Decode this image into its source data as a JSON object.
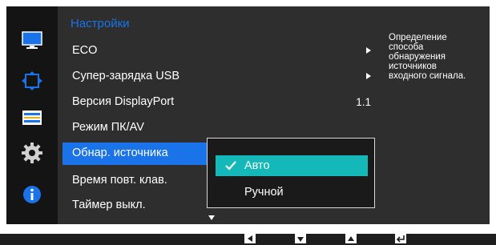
{
  "menu": {
    "title": "Настройки",
    "items": [
      {
        "label": "ECO",
        "value": "",
        "has_submenu": true
      },
      {
        "label": "Супер-зарядка USB",
        "value": "",
        "has_submenu": true
      },
      {
        "label": "Версия DisplayPort",
        "value": "1.1",
        "has_submenu": false
      },
      {
        "label": "Режим ПК/AV",
        "value": "",
        "has_submenu": false
      },
      {
        "label": "Обнар. источника",
        "value": "",
        "has_submenu": false,
        "selected": true
      },
      {
        "label": "Время повт. клав.",
        "value": "",
        "has_submenu": false
      },
      {
        "label": "Таймер выкл.",
        "value": "",
        "has_submenu": false
      }
    ]
  },
  "submenu": {
    "options": [
      {
        "label": "Авто",
        "checked": true
      },
      {
        "label": "Ручной",
        "checked": false
      }
    ]
  },
  "description": {
    "lines": [
      "Определение",
      "способа",
      "обнаружения",
      "источников",
      "входного сигнала."
    ]
  },
  "side_icons": [
    "picture-icon",
    "position-icon",
    "color-icon",
    "settings-gear-icon",
    "info-icon"
  ],
  "keys": [
    "left-arrow-key-icon",
    "down-arrow-key-icon",
    "up-arrow-key-icon",
    "return-key-icon"
  ],
  "colors": {
    "accent_blue": "#1a73e8",
    "highlight_teal": "#14b8b8",
    "panel_dark": "#2e2e2e",
    "icon_column": "#141414"
  }
}
